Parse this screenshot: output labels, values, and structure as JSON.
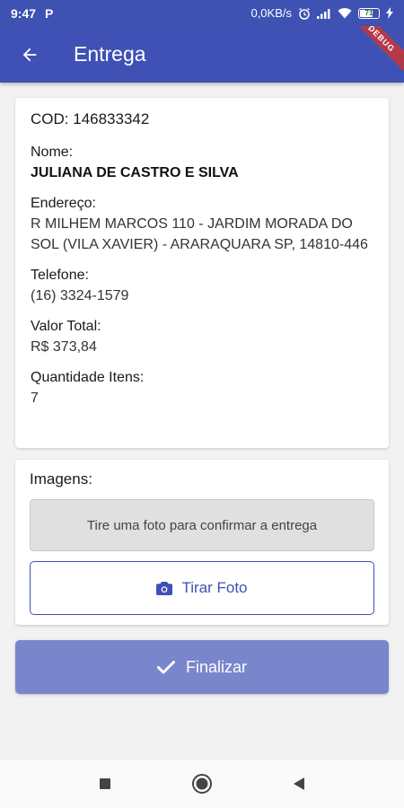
{
  "status_bar": {
    "time": "9:47",
    "app_indicator": "P",
    "network_speed": "0,0KB/s",
    "battery_level": "71"
  },
  "app_bar": {
    "title": "Entrega",
    "debug_banner": "DEBUG",
    "color": "#3f51b5"
  },
  "delivery": {
    "code_label": "COD:",
    "code_value": "146833342",
    "name_label": "Nome:",
    "name_value": "JULIANA DE CASTRO E SILVA",
    "address_label": "Endereço:",
    "address_value": "R MILHEM MARCOS 110 - JARDIM MORADA DO SOL (VILA XAVIER) - ARARAQUARA SP, 14810-446",
    "phone_label": "Telefone:",
    "phone_value": "(16) 3324-1579",
    "total_label": "Valor Total:",
    "total_value": "R$ 373,84",
    "qty_label": "Quantidade Itens:",
    "qty_value": "7"
  },
  "images": {
    "label": "Imagens:",
    "placeholder": "Tire uma foto para confirmar a entrega",
    "take_photo_label": "Tirar Foto"
  },
  "actions": {
    "finalize_label": "Finalizar",
    "finalize_color": "#7986cb"
  }
}
